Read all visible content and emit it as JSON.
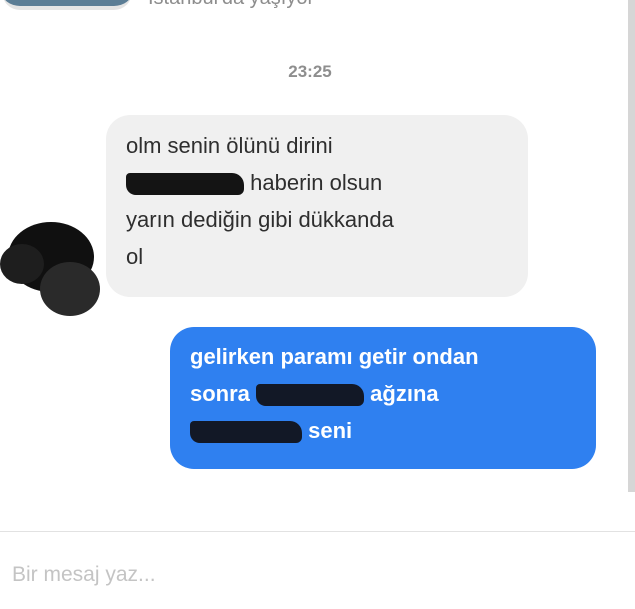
{
  "header": {
    "location": "İstanbul'da yaşıyor"
  },
  "conversation": {
    "timestamp": "23:25",
    "incoming": {
      "line1": "olm senin ölünü dirini",
      "line2_after_redaction": "haberin olsun",
      "line3": "yarın dediğin gibi dükkanda",
      "line4": "ol"
    },
    "outgoing": {
      "line1": "gelirken paramı getir ondan",
      "line2_before_redaction": "sonra",
      "line2_after_redaction": "ağzına",
      "line3_after_redaction": "seni"
    }
  },
  "composer": {
    "placeholder": "Bir mesaj yaz..."
  },
  "colors": {
    "incoming_bubble": "#f0f0f0",
    "outgoing_bubble": "#2f80f0",
    "timestamp": "#8e8e8e"
  }
}
